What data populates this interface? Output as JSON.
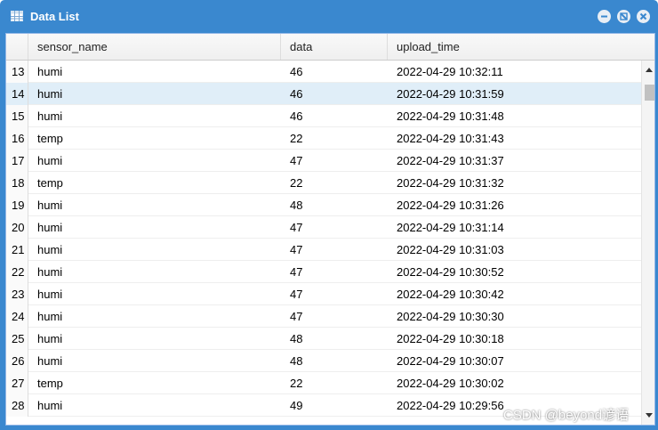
{
  "window": {
    "title": "Data List",
    "icons": {
      "title": "table-icon",
      "min": "minimize-icon",
      "max": "maximize-icon",
      "close": "close-icon"
    }
  },
  "grid": {
    "columns": [
      "",
      "sensor_name",
      "data",
      "upload_time"
    ],
    "rows": [
      {
        "num": "13",
        "sensor_name": "humi",
        "data": "46",
        "upload_time": "2022-04-29 10:32:11"
      },
      {
        "num": "14",
        "sensor_name": "humi",
        "data": "46",
        "upload_time": "2022-04-29 10:31:59"
      },
      {
        "num": "15",
        "sensor_name": "humi",
        "data": "46",
        "upload_time": "2022-04-29 10:31:48"
      },
      {
        "num": "16",
        "sensor_name": "temp",
        "data": "22",
        "upload_time": "2022-04-29 10:31:43"
      },
      {
        "num": "17",
        "sensor_name": "humi",
        "data": "47",
        "upload_time": "2022-04-29 10:31:37"
      },
      {
        "num": "18",
        "sensor_name": "temp",
        "data": "22",
        "upload_time": "2022-04-29 10:31:32"
      },
      {
        "num": "19",
        "sensor_name": "humi",
        "data": "48",
        "upload_time": "2022-04-29 10:31:26"
      },
      {
        "num": "20",
        "sensor_name": "humi",
        "data": "47",
        "upload_time": "2022-04-29 10:31:14"
      },
      {
        "num": "21",
        "sensor_name": "humi",
        "data": "47",
        "upload_time": "2022-04-29 10:31:03"
      },
      {
        "num": "22",
        "sensor_name": "humi",
        "data": "47",
        "upload_time": "2022-04-29 10:30:52"
      },
      {
        "num": "23",
        "sensor_name": "humi",
        "data": "47",
        "upload_time": "2022-04-29 10:30:42"
      },
      {
        "num": "24",
        "sensor_name": "humi",
        "data": "47",
        "upload_time": "2022-04-29 10:30:30"
      },
      {
        "num": "25",
        "sensor_name": "humi",
        "data": "48",
        "upload_time": "2022-04-29 10:30:18"
      },
      {
        "num": "26",
        "sensor_name": "humi",
        "data": "48",
        "upload_time": "2022-04-29 10:30:07"
      },
      {
        "num": "27",
        "sensor_name": "temp",
        "data": "22",
        "upload_time": "2022-04-29 10:30:02"
      },
      {
        "num": "28",
        "sensor_name": "humi",
        "data": "49",
        "upload_time": "2022-04-29 10:29:56"
      }
    ],
    "selected_row": "14"
  },
  "watermark": "CSDN @beyond谚语",
  "colors": {
    "titlebar": "#3a88cf",
    "selected_row": "#e0eef8"
  }
}
